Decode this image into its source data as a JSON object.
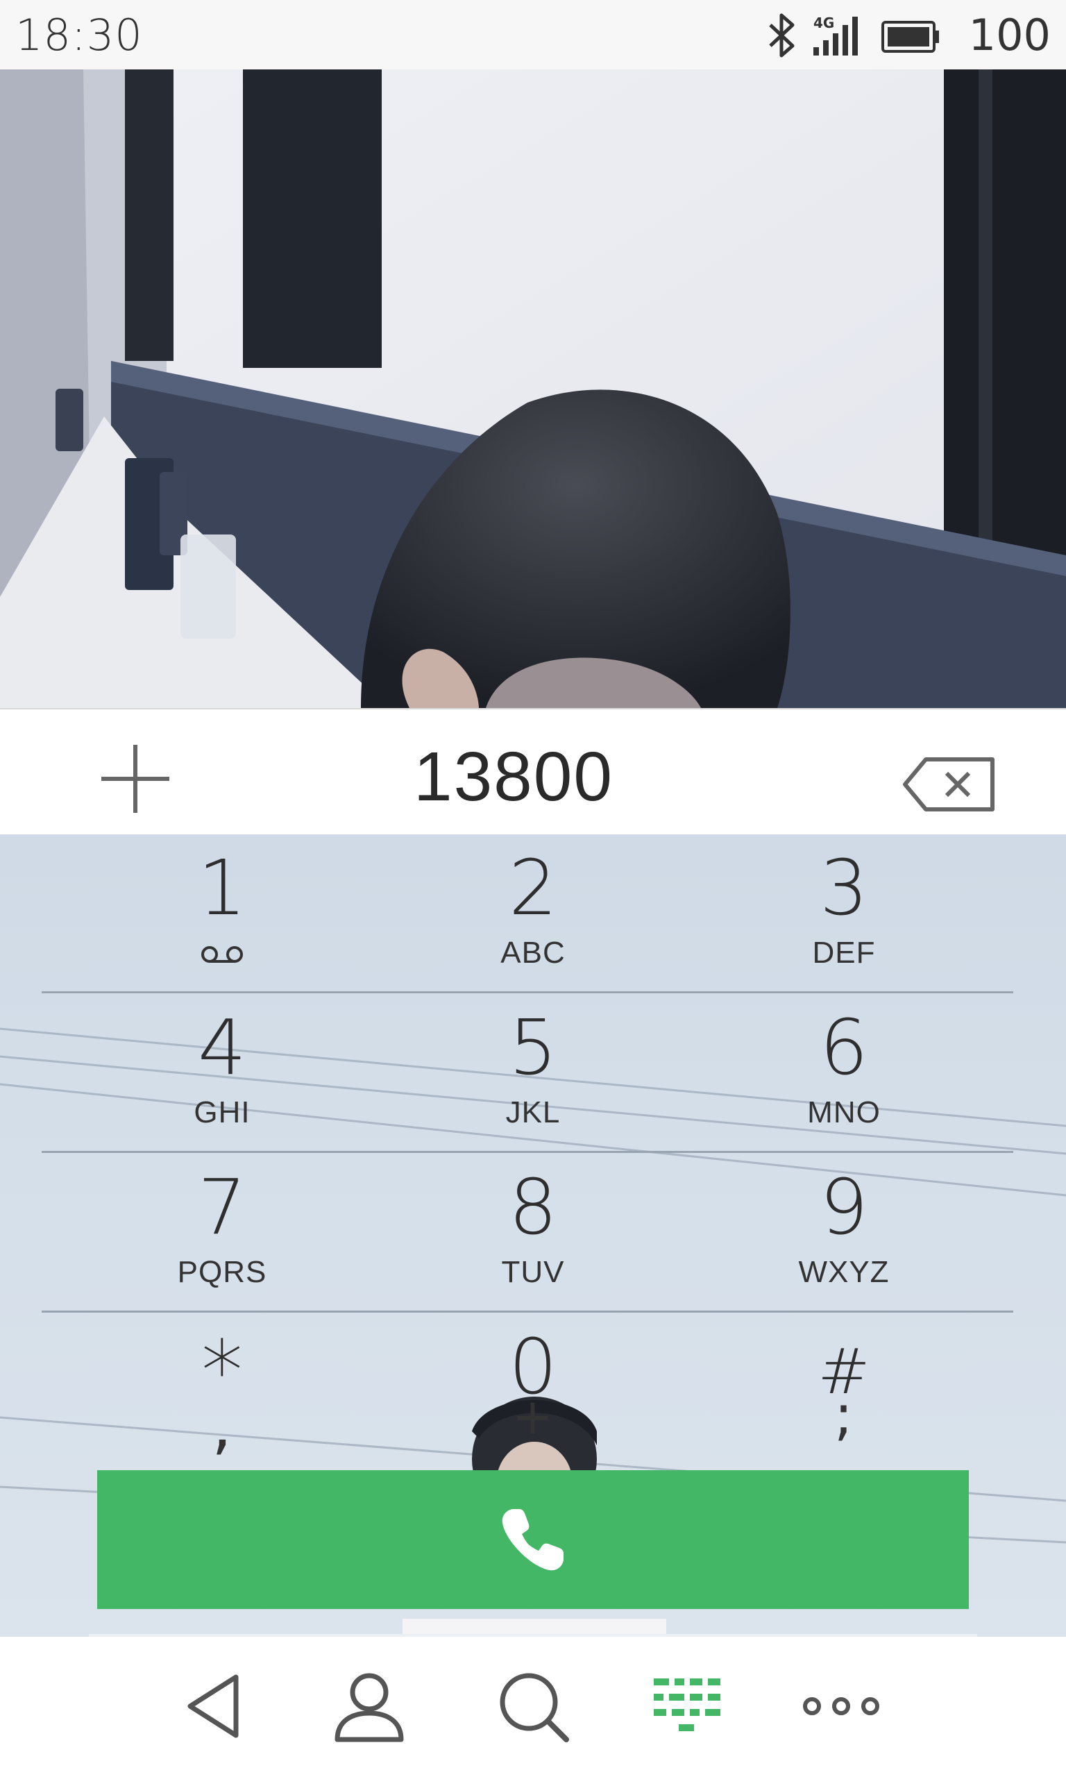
{
  "status_bar": {
    "time": "18:30",
    "battery_level": "100",
    "icons": [
      "bluetooth-icon",
      "signal-4g-icon",
      "battery-icon"
    ]
  },
  "dialer": {
    "number": "13800",
    "add_icon": "plus-icon",
    "backspace_icon": "backspace-icon"
  },
  "keypad": {
    "keys": [
      {
        "digit": "1",
        "letters": "",
        "icon": "voicemail-icon"
      },
      {
        "digit": "2",
        "letters": "ABC"
      },
      {
        "digit": "3",
        "letters": "DEF"
      },
      {
        "digit": "4",
        "letters": "GHI"
      },
      {
        "digit": "5",
        "letters": "JKL"
      },
      {
        "digit": "6",
        "letters": "MNO"
      },
      {
        "digit": "7",
        "letters": "PQRS"
      },
      {
        "digit": "8",
        "letters": "TUV"
      },
      {
        "digit": "9",
        "letters": "WXYZ"
      },
      {
        "digit": "*",
        "letters": ","
      },
      {
        "digit": "0",
        "letters": "+"
      },
      {
        "digit": "#",
        "letters": ";"
      }
    ]
  },
  "call_button": {
    "icon": "phone-icon",
    "color": "#43b766"
  },
  "bottom_nav": {
    "items": [
      {
        "icon": "back-triangle-icon"
      },
      {
        "icon": "contacts-person-icon"
      },
      {
        "icon": "search-icon"
      },
      {
        "icon": "dialpad-icon",
        "active": true
      },
      {
        "icon": "more-dots-icon"
      }
    ],
    "active_color": "#43b766"
  }
}
